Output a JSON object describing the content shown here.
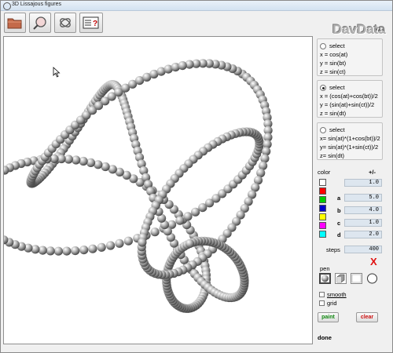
{
  "window": {
    "title": "3D Lissajous figures"
  },
  "brand": {
    "name": "DavData",
    "version": "v1.1"
  },
  "equations": [
    {
      "select_label": "select",
      "selected": false,
      "lines": [
        "x = cos(at)",
        "y = sin(bt)",
        "z = sin(ct)"
      ]
    },
    {
      "select_label": "select",
      "selected": true,
      "lines": [
        "x = (cos(at)+cos(bt))/2",
        "y = (sin(at)+sin(ct))/2",
        "z = sin(dt)"
      ]
    },
    {
      "select_label": "select",
      "selected": false,
      "lines": [
        "x= sin(at)*(1+cos(bt))/2",
        "y= sin(at)*(1+sin(ct))/2",
        "z= sin(dt)"
      ]
    }
  ],
  "params": {
    "color_label": "color",
    "pm_label": "+/-",
    "pm_value": "1.0",
    "a_label": "a",
    "a_value": "5.0",
    "b_label": "b",
    "b_value": "4.0",
    "c_label": "c",
    "c_value": "1.0",
    "d_label": "d",
    "d_value": "2.0",
    "steps_label": "steps",
    "steps_value": "400",
    "clear_x": "X"
  },
  "swatch_colors": [
    "#ffffff",
    "#ff0000",
    "#00cc00",
    "#0000cc",
    "#ffff00",
    "#ff00ff",
    "#00ffff"
  ],
  "pen": {
    "label": "pen"
  },
  "options": {
    "smooth_label": "smooth",
    "grid_label": "grid"
  },
  "buttons": {
    "paint_label": "paint",
    "clear_label": "clear"
  },
  "status": {
    "text": "done"
  }
}
